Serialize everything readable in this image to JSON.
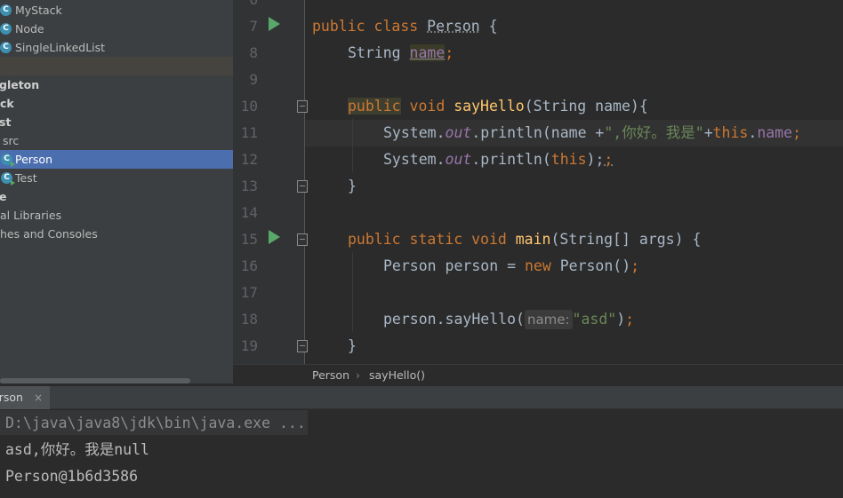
{
  "project_tree": {
    "items": [
      {
        "label": "MyStack",
        "icon": "class-icon"
      },
      {
        "label": "Node",
        "icon": "class-icon"
      },
      {
        "label": "SingleLinkedList",
        "icon": "class-icon"
      },
      {
        "label": ""
      },
      {
        "label": "gleton"
      },
      {
        "label": "ck"
      },
      {
        "label": "st"
      },
      {
        "label": "src",
        "icon": "folder-icon"
      },
      {
        "label": "Person",
        "icon": "class-icon",
        "selected": true
      },
      {
        "label": "Test",
        "icon": "class-icon"
      },
      {
        "label": "e"
      },
      {
        "label": "al Libraries",
        "icon": "library-icon"
      },
      {
        "label": "hes and Consoles",
        "icon": "console-icon"
      }
    ]
  },
  "editor": {
    "line_numbers": [
      "6",
      "7",
      "8",
      "9",
      "10",
      "11",
      "12",
      "13",
      "14",
      "15",
      "16",
      "17",
      "18",
      "19"
    ],
    "code": {
      "l7_kw": "public class ",
      "l7_name": "Person",
      "l7_rest": " {",
      "l8_type": "String ",
      "l8_field": "name",
      "l8_semi": ";",
      "l10_public": "public",
      "l10_void": " void ",
      "l10_method": "sayHello",
      "l10_params": "(String name){",
      "l11_sys": "System.",
      "l11_out": "out",
      "l11_call": ".println(name +",
      "l11_str": "\",你好。我是\"",
      "l11_plus": "+",
      "l11_this": "this",
      "l11_dot": ".",
      "l11_field": "name",
      "l11_semi": ";",
      "l12_sys": "System.",
      "l12_out": "out",
      "l12_call": ".println(",
      "l12_this": "this",
      "l12_close": ");",
      "l12_semi": ";",
      "l13": "}",
      "l15_kw": "public static void ",
      "l15_method": "main",
      "l15_params": "(String[] args) {",
      "l16_a": "Person person = ",
      "l16_new": "new",
      "l16_b": " Person()",
      "l16_semi": ";",
      "l18_call": "person.sayHello(",
      "l18_hint": "name:",
      "l18_str": "\"asd\"",
      "l18_close": ")",
      "l18_semi": ";",
      "l19": "}"
    }
  },
  "breadcrumb": {
    "items": [
      "Person",
      "sayHello()"
    ],
    "separator": "›"
  },
  "run_panel": {
    "tab_label": "erson",
    "tab_close": "×",
    "console_lines": [
      "D:\\java\\java8\\jdk\\bin\\java.exe ...",
      "asd,你好。我是null",
      "Person@1b6d3586"
    ]
  },
  "colors": {
    "keyword": "#cc7832",
    "method": "#ffc66d",
    "string": "#6a8759",
    "field": "#9876aa",
    "selection": "#4b6eaf",
    "run_icon": "#59a869"
  }
}
